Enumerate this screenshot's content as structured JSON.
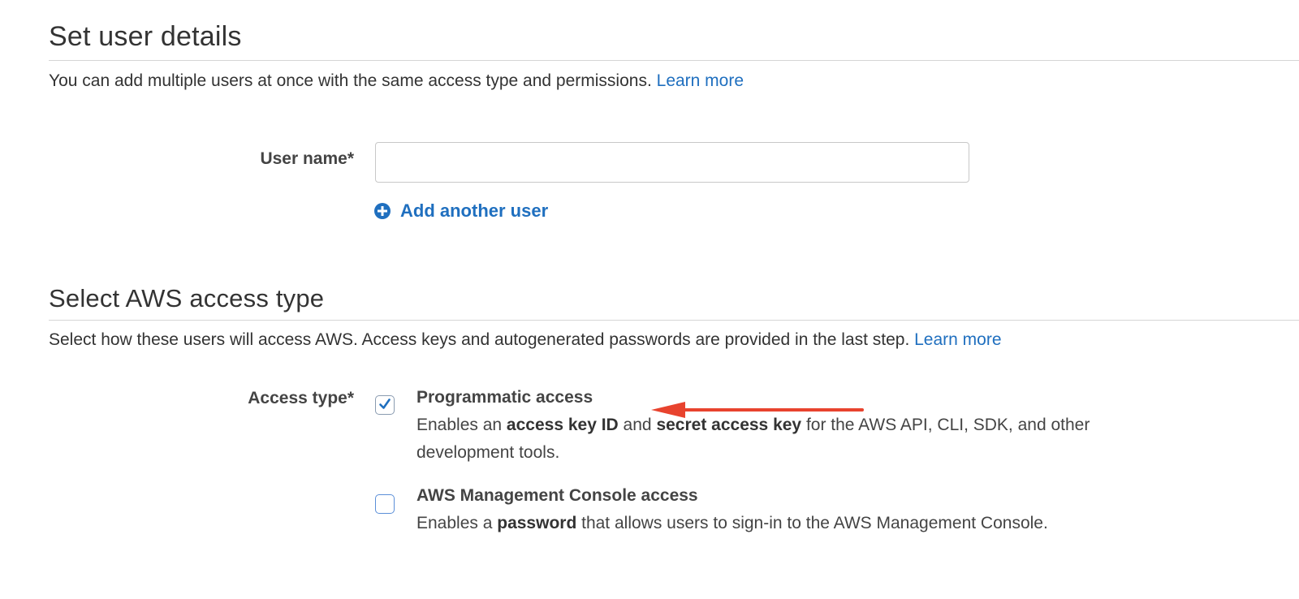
{
  "user_details": {
    "title": "Set user details",
    "description": "You can add multiple users at once with the same access type and permissions.",
    "learn_more": "Learn more",
    "username_label": "User name*",
    "username_value": "",
    "add_another_user": "Add another user"
  },
  "access_type": {
    "title": "Select AWS access type",
    "description": "Select how these users will access AWS. Access keys and autogenerated passwords are provided in the last step.",
    "learn_more": "Learn more",
    "label": "Access type*",
    "options": [
      {
        "title": "Programmatic access",
        "checked": true,
        "desc_parts": [
          "Enables an ",
          "access key ID",
          " and ",
          "secret access key",
          " for the AWS API, CLI, SDK, and other development tools."
        ]
      },
      {
        "title": "AWS Management Console access",
        "checked": false,
        "desc_parts": [
          "Enables a ",
          "password",
          " that allows users to sign-in to the AWS Management Console."
        ]
      }
    ]
  },
  "colors": {
    "link": "#1f6fbf",
    "annotation_arrow": "#e8432e",
    "checkmark": "#1f6fbf"
  },
  "icons": {
    "add_user": "plus-circle-icon",
    "checked": "checkmark-icon"
  }
}
